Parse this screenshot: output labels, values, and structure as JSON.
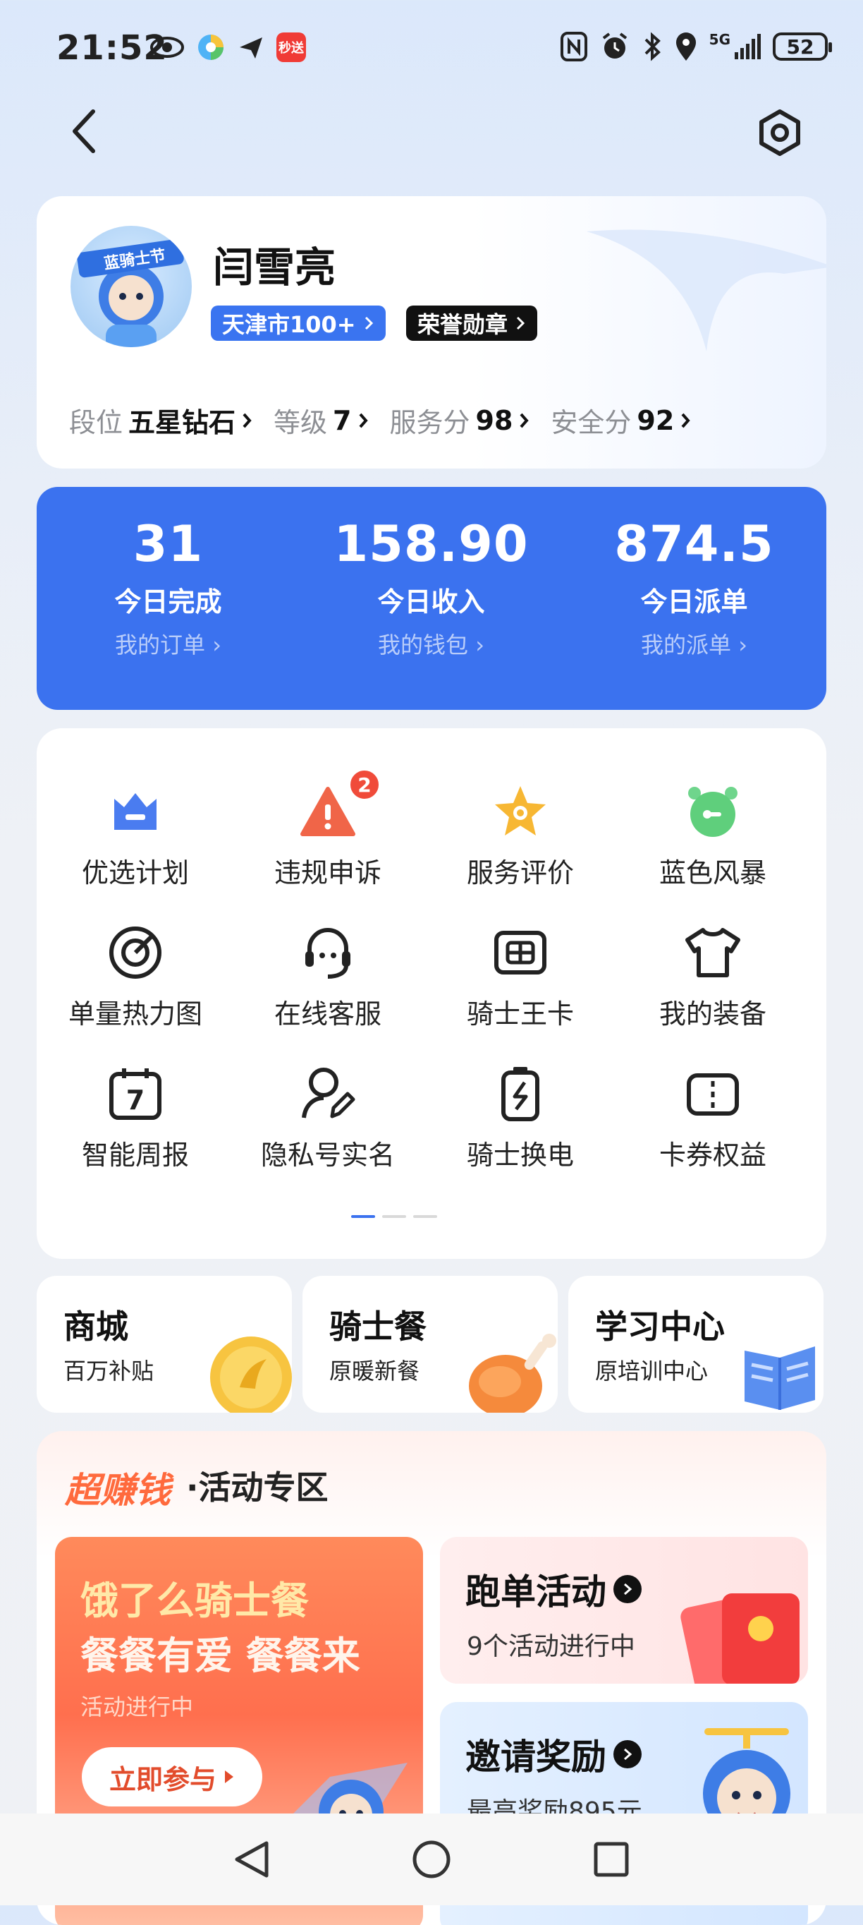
{
  "status_bar": {
    "time": "21:52",
    "battery": "52",
    "left_icons": [
      "eye-icon",
      "app-colorful-icon",
      "send-plane-icon",
      "miaosong-app-icon"
    ],
    "miaosong_label": "秒送",
    "right_icons": [
      "nfc-icon",
      "alarm-icon",
      "bluetooth-icon",
      "location-icon",
      "signal-5g-icon",
      "battery-icon"
    ],
    "network": "5G"
  },
  "nav": {
    "back_icon": "chevron-left-icon",
    "settings_icon": "settings-hexagon-icon"
  },
  "profile": {
    "name": "闫雪亮",
    "avatar_badge": "蓝骑士节",
    "city_badge": "天津市100+",
    "honor_badge": "荣誉勋章",
    "stats": [
      {
        "label": "段位",
        "value": "五星钻石"
      },
      {
        "label": "等级",
        "value": "7"
      },
      {
        "label": "服务分",
        "value": "98"
      },
      {
        "label": "安全分",
        "value": "92"
      }
    ]
  },
  "summary": [
    {
      "value": "31",
      "label": "今日完成",
      "link": "我的订单"
    },
    {
      "value": "158.90",
      "label": "今日收入",
      "link": "我的钱包"
    },
    {
      "value": "874.5",
      "label": "今日派单",
      "link": "我的派单"
    }
  ],
  "grid": [
    {
      "label": "优选计划",
      "icon": "crown-icon"
    },
    {
      "label": "违规申诉",
      "icon": "warning-icon",
      "badge": "2"
    },
    {
      "label": "服务评价",
      "icon": "star-icon"
    },
    {
      "label": "蓝色风暴",
      "icon": "alarm-clock-icon"
    },
    {
      "label": "单量热力图",
      "icon": "target-icon"
    },
    {
      "label": "在线客服",
      "icon": "headset-icon"
    },
    {
      "label": "骑士王卡",
      "icon": "sim-card-icon"
    },
    {
      "label": "我的装备",
      "icon": "tshirt-icon"
    },
    {
      "label": "智能周报",
      "icon": "calendar-icon",
      "icon_text": "7"
    },
    {
      "label": "隐私号实名",
      "icon": "user-edit-icon"
    },
    {
      "label": "骑士换电",
      "icon": "battery-swap-icon"
    },
    {
      "label": "卡券权益",
      "icon": "coupon-icon"
    }
  ],
  "features": [
    {
      "title": "商城",
      "sub": "百万补贴",
      "icon": "coin-icon"
    },
    {
      "title": "骑士餐",
      "sub": "原暖新餐",
      "icon": "chicken-leg-icon"
    },
    {
      "title": "学习中心",
      "sub": "原培训中心",
      "icon": "book-icon"
    }
  ],
  "activity": {
    "brand": "超赚钱",
    "title": "·活动专区",
    "promo_big": {
      "line1": "饿了么骑士餐",
      "line2": "餐餐有爱 餐餐来",
      "status": "活动进行中",
      "button": "立即参与"
    },
    "promo_run": {
      "title": "跑单活动",
      "sub": "9个活动进行中"
    },
    "promo_invite": {
      "title": "邀请奖励",
      "sub": "最高奖励895元"
    }
  },
  "bottom_nav": [
    "back-triangle-icon",
    "home-circle-icon",
    "recents-square-icon"
  ],
  "colors": {
    "primary_blue": "#3b72ef",
    "orange": "#ff6a3d",
    "badge_red": "#f04b3a"
  }
}
